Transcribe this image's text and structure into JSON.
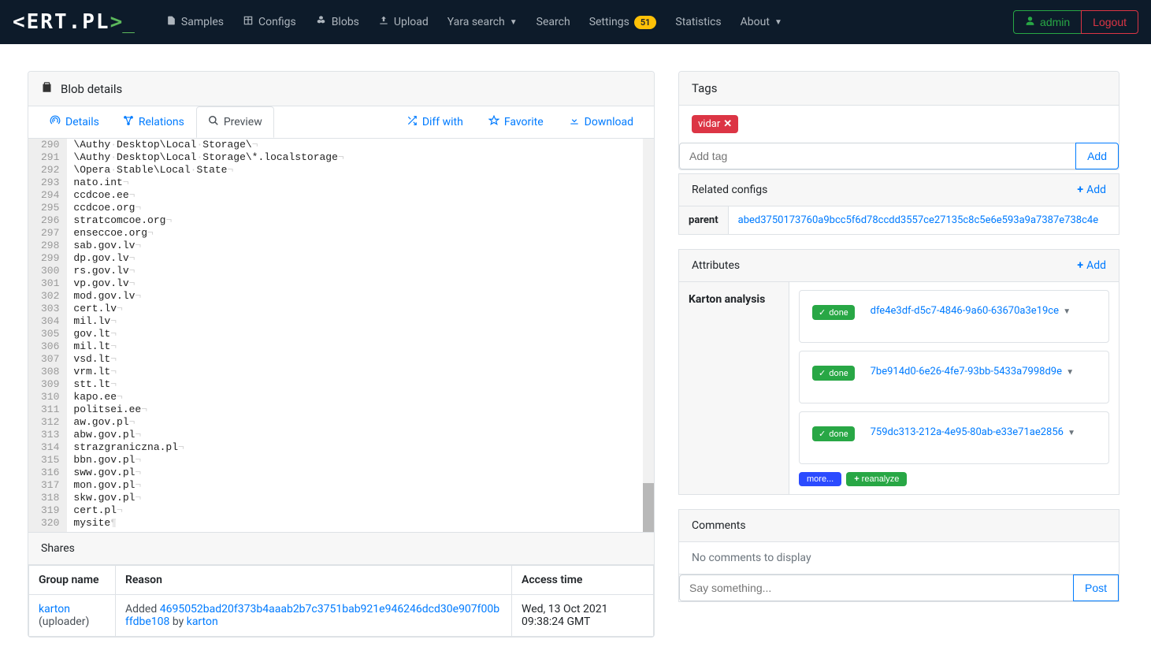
{
  "nav": {
    "brand_text": "<ERT.PL",
    "brand_angle": ">",
    "brand_under": "_",
    "samples": "Samples",
    "configs": "Configs",
    "blobs": "Blobs",
    "upload": "Upload",
    "yara": "Yara search",
    "search": "Search",
    "settings": "Settings",
    "settings_badge": "51",
    "statistics": "Statistics",
    "about": "About",
    "admin": "admin",
    "logout": "Logout"
  },
  "blob": {
    "header": "Blob details",
    "tabs": {
      "details": "Details",
      "relations": "Relations",
      "preview": "Preview"
    },
    "actions": {
      "diff": "Diff with",
      "favorite": "Favorite",
      "download": "Download"
    },
    "code_start_line": 290,
    "code_lines": [
      "\\Authy Desktop\\Local Storage\\",
      "\\Authy Desktop\\Local Storage\\*.localstorage",
      "\\Opera Stable\\Local State",
      "nato.int",
      "ccdcoe.ee",
      "ccdcoe.org",
      "stratcomcoe.org",
      "enseccoe.org",
      "sab.gov.lv",
      "dp.gov.lv",
      "rs.gov.lv",
      "vp.gov.lv",
      "mod.gov.lv",
      "cert.lv",
      "mil.lv",
      "gov.lt",
      "mil.lt",
      "vsd.lt",
      "vrm.lt",
      "stt.lt",
      "kapo.ee",
      "politsei.ee",
      "aw.gov.pl",
      "abw.gov.pl",
      "strazgraniczna.pl",
      "bbn.gov.pl",
      "sww.gov.pl",
      "mon.gov.pl",
      "skw.gov.pl",
      "cert.pl",
      "mysite"
    ],
    "eol": "¬",
    "eof": "¶",
    "ws_dot": "·"
  },
  "shares": {
    "header": "Shares",
    "cols": {
      "group": "Group name",
      "reason": "Reason",
      "time": "Access time"
    },
    "rows": [
      {
        "group_link": "karton",
        "group_suffix": "  (uploader)",
        "reason_prefix": "Added ",
        "reason_hash": "4695052bad20f373b4aaab2b7c3751bab921e946246dcd30e907f00bffdbe108",
        "reason_by": " by ",
        "reason_user": "karton",
        "time": "Wed, 13 Oct 2021 09:38:24 GMT"
      }
    ]
  },
  "tags": {
    "header": "Tags",
    "chip": "vidar",
    "input_placeholder": "Add tag",
    "add": "Add"
  },
  "related": {
    "header": "Related configs",
    "add": "Add",
    "rows": [
      {
        "key": "parent",
        "hash": "abed3750173760a9bcc5f6d78ccdd3557ce27135c8c5e6e593a9a7387e738c4e"
      }
    ]
  },
  "attrs": {
    "header": "Attributes",
    "add": "Add",
    "karton_label": "Karton analysis",
    "done": "done",
    "analyses": [
      "dfe4e3df-d5c7-4846-9a60-63670a3e19ce",
      "7be914d0-6e26-4fe7-93bb-5433a7998d9e",
      "759dc313-212a-4e95-80ab-e33e71ae2856"
    ],
    "more": "more...",
    "reanalyze": "reanalyze"
  },
  "comments": {
    "header": "Comments",
    "empty": "No comments to display",
    "placeholder": "Say something...",
    "post": "Post"
  }
}
